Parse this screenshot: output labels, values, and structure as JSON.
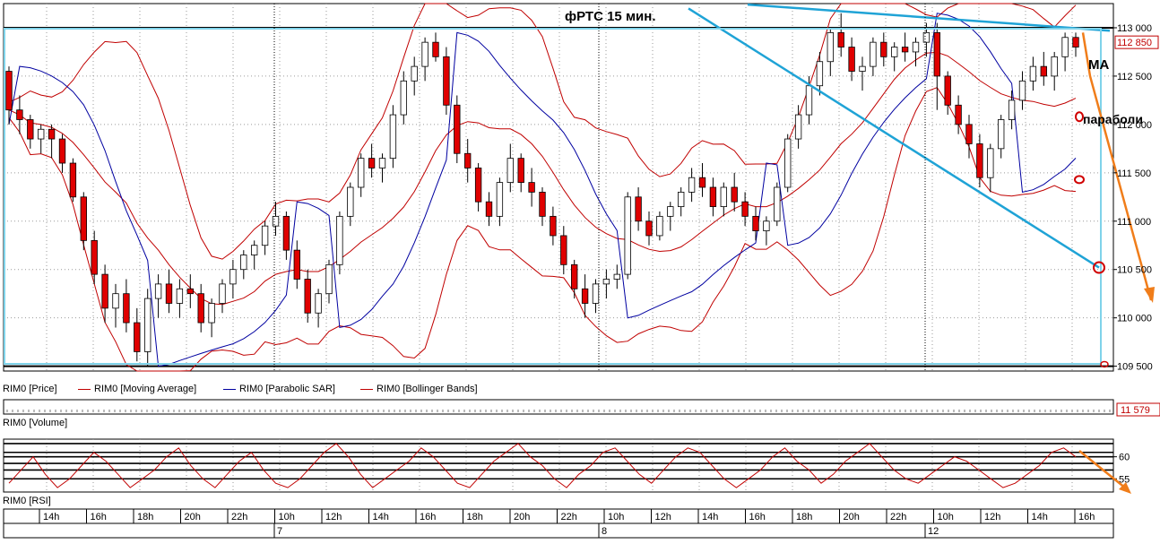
{
  "chart_data": {
    "type": "candlestick",
    "title": "фРТС   15 мин.",
    "price_panel": {
      "ylim": [
        109450,
        113250
      ],
      "yticks": [
        109500,
        110000,
        110500,
        111000,
        111500,
        112000,
        112500,
        113000
      ],
      "ytick_labels": [
        "109 500",
        "110 000",
        "110 500",
        "111 000",
        "111 500",
        "112 000",
        "112 500",
        "113 000"
      ],
      "last_price_label": "112 850",
      "last_price": 112850,
      "hlines": [
        113000,
        109500
      ],
      "candles_ohlc": [
        [
          112550,
          112600,
          112000,
          112150
        ],
        [
          112150,
          112300,
          111900,
          112050
        ],
        [
          112050,
          112100,
          111750,
          111850
        ],
        [
          111850,
          112000,
          111700,
          111950
        ],
        [
          111950,
          112000,
          111650,
          111850
        ],
        [
          111850,
          111900,
          111500,
          111600
        ],
        [
          111600,
          111650,
          111200,
          111250
        ],
        [
          111250,
          111300,
          110700,
          110800
        ],
        [
          110800,
          110900,
          110350,
          110450
        ],
        [
          110450,
          110550,
          109950,
          110100
        ],
        [
          110100,
          110350,
          109900,
          110250
        ],
        [
          110250,
          110400,
          109850,
          109950
        ],
        [
          109950,
          110100,
          109550,
          109650
        ],
        [
          109650,
          110300,
          109500,
          110200
        ],
        [
          110200,
          110450,
          110000,
          110350
        ],
        [
          110350,
          110500,
          110050,
          110150
        ],
        [
          110150,
          110400,
          110000,
          110300
        ],
        [
          110300,
          110450,
          110100,
          110250
        ],
        [
          110250,
          110350,
          109850,
          109950
        ],
        [
          109950,
          110200,
          109800,
          110150
        ],
        [
          110150,
          110400,
          110050,
          110350
        ],
        [
          110350,
          110600,
          110200,
          110500
        ],
        [
          110500,
          110700,
          110400,
          110650
        ],
        [
          110650,
          110800,
          110500,
          110750
        ],
        [
          110750,
          111000,
          110650,
          110950
        ],
        [
          110950,
          111200,
          110850,
          111050
        ],
        [
          111050,
          111100,
          110600,
          110700
        ],
        [
          110700,
          110800,
          110300,
          110400
        ],
        [
          110400,
          110500,
          109950,
          110050
        ],
        [
          110050,
          110300,
          109900,
          110250
        ],
        [
          110250,
          110600,
          110150,
          110550
        ],
        [
          110550,
          111100,
          110450,
          111050
        ],
        [
          111050,
          111400,
          110950,
          111350
        ],
        [
          111350,
          111700,
          111250,
          111650
        ],
        [
          111650,
          111800,
          111450,
          111550
        ],
        [
          111550,
          111700,
          111400,
          111650
        ],
        [
          111650,
          112200,
          111550,
          112100
        ],
        [
          112100,
          112550,
          112000,
          112450
        ],
        [
          112450,
          112700,
          112300,
          112600
        ],
        [
          112600,
          112900,
          112450,
          112850
        ],
        [
          112850,
          112950,
          112650,
          112700
        ],
        [
          112700,
          112800,
          112100,
          112200
        ],
        [
          112200,
          112300,
          111600,
          111700
        ],
        [
          111700,
          111850,
          111400,
          111550
        ],
        [
          111550,
          111600,
          111100,
          111200
        ],
        [
          111200,
          111300,
          110950,
          111050
        ],
        [
          111050,
          111450,
          110950,
          111400
        ],
        [
          111400,
          111800,
          111300,
          111650
        ],
        [
          111650,
          111700,
          111300,
          111400
        ],
        [
          111400,
          111550,
          111150,
          111300
        ],
        [
          111300,
          111350,
          110950,
          111050
        ],
        [
          111050,
          111150,
          110750,
          110850
        ],
        [
          110850,
          110950,
          110450,
          110550
        ],
        [
          110550,
          110600,
          110200,
          110300
        ],
        [
          110300,
          110450,
          110000,
          110150
        ],
        [
          110150,
          110400,
          110050,
          110350
        ],
        [
          110350,
          110500,
          110200,
          110400
        ],
        [
          110400,
          110550,
          110300,
          110450
        ],
        [
          110450,
          111300,
          110400,
          111250
        ],
        [
          111250,
          111350,
          110900,
          111000
        ],
        [
          111000,
          111100,
          110750,
          110850
        ],
        [
          110850,
          111100,
          110800,
          111050
        ],
        [
          111050,
          111200,
          110900,
          111150
        ],
        [
          111150,
          111350,
          111050,
          111300
        ],
        [
          111300,
          111550,
          111200,
          111450
        ],
        [
          111450,
          111600,
          111250,
          111350
        ],
        [
          111350,
          111450,
          111050,
          111150
        ],
        [
          111150,
          111400,
          111050,
          111350
        ],
        [
          111350,
          111500,
          111100,
          111200
        ],
        [
          111200,
          111300,
          110950,
          111050
        ],
        [
          111050,
          111150,
          110800,
          110900
        ],
        [
          110900,
          111050,
          110750,
          111000
        ],
        [
          111000,
          111400,
          110950,
          111350
        ],
        [
          111350,
          111900,
          111300,
          111850
        ],
        [
          111850,
          112200,
          111750,
          112100
        ],
        [
          112100,
          112500,
          112000,
          112400
        ],
        [
          112400,
          112750,
          112300,
          112650
        ],
        [
          112650,
          113000,
          112500,
          112950
        ],
        [
          112950,
          113150,
          112700,
          112800
        ],
        [
          112800,
          112900,
          112450,
          112550
        ],
        [
          112550,
          112700,
          112350,
          112600
        ],
        [
          112600,
          112900,
          112500,
          112850
        ],
        [
          112850,
          112950,
          112600,
          112700
        ],
        [
          112700,
          112850,
          112550,
          112800
        ],
        [
          112800,
          112950,
          112650,
          112750
        ],
        [
          112750,
          112900,
          112600,
          112850
        ],
        [
          112850,
          113050,
          112700,
          112950
        ],
        [
          112950,
          113050,
          112150,
          112500
        ],
        [
          112500,
          112550,
          112100,
          112200
        ],
        [
          112200,
          112300,
          111900,
          112000
        ],
        [
          112000,
          112100,
          111650,
          111800
        ],
        [
          111800,
          111900,
          111350,
          111450
        ],
        [
          111450,
          111800,
          111300,
          111750
        ],
        [
          111750,
          112100,
          111650,
          112050
        ],
        [
          112050,
          112350,
          111950,
          112250
        ],
        [
          112250,
          112550,
          112150,
          112450
        ],
        [
          112450,
          112700,
          112350,
          112600
        ],
        [
          112600,
          112750,
          112400,
          112500
        ],
        [
          112500,
          112750,
          112350,
          112700
        ],
        [
          112700,
          112950,
          112550,
          112900
        ],
        [
          112900,
          112950,
          112700,
          112800
        ]
      ]
    },
    "legend": [
      {
        "name": "RIM0 [Price]",
        "color": "#000000"
      },
      {
        "name": "RIM0 [Moving Average]",
        "color": "#c00000"
      },
      {
        "name": "RIM0 [Parabolic SAR]",
        "color": "#0000a0"
      },
      {
        "name": "RIM0 [Bollinger Bands]",
        "color": "#c00000"
      }
    ],
    "volume_panel": {
      "title": "RIM0 [Volume]",
      "last_value_label": "11 579"
    },
    "rsi_panel": {
      "title": "RIM0 [RSI]",
      "ytick_labels": [
        "60",
        "55"
      ],
      "ylim": [
        52,
        64
      ],
      "hlines": [
        63,
        61,
        60,
        58.5,
        57,
        55
      ],
      "values": [
        54,
        57,
        60,
        56,
        53,
        55,
        58,
        61,
        59,
        56,
        53,
        55,
        57,
        60,
        62,
        58,
        55,
        53,
        56,
        59,
        61,
        57,
        54,
        53,
        55,
        58,
        61,
        63,
        60,
        56,
        53,
        55,
        57,
        59,
        62,
        60,
        57,
        54,
        53,
        56,
        59,
        61,
        63,
        60,
        58,
        55,
        53,
        56,
        58,
        61,
        62,
        59,
        56,
        54,
        57,
        60,
        62,
        61,
        58,
        55,
        53,
        55,
        57,
        60,
        62,
        59,
        57,
        54,
        56,
        59,
        61,
        63,
        60,
        57,
        55,
        54,
        56,
        58,
        60,
        59,
        57,
        55,
        53,
        54,
        56,
        58,
        61,
        62,
        60
      ]
    },
    "x_axis": {
      "tick_labels": [
        "14h",
        "16h",
        "18h",
        "20h",
        "22h",
        "10h",
        "12h",
        "14h",
        "16h",
        "18h",
        "20h",
        "22h",
        "10h",
        "12h",
        "14h",
        "16h",
        "18h",
        "20h",
        "22h",
        "10h",
        "12h",
        "14h",
        "16h"
      ],
      "date_labels": [
        "7",
        "8",
        "12"
      ]
    },
    "annotations": {
      "ma_label": "MA",
      "parabolic_label": "параболи"
    },
    "colors": {
      "bear_candle": "#e00000",
      "bull_candle": "#ffffff",
      "ma_bands": "#c00000",
      "sar": "#0000a0",
      "trendline": "#1fa3d6",
      "forecast_arrow": "#f07d1a",
      "frame": "#7fd3ea"
    }
  }
}
